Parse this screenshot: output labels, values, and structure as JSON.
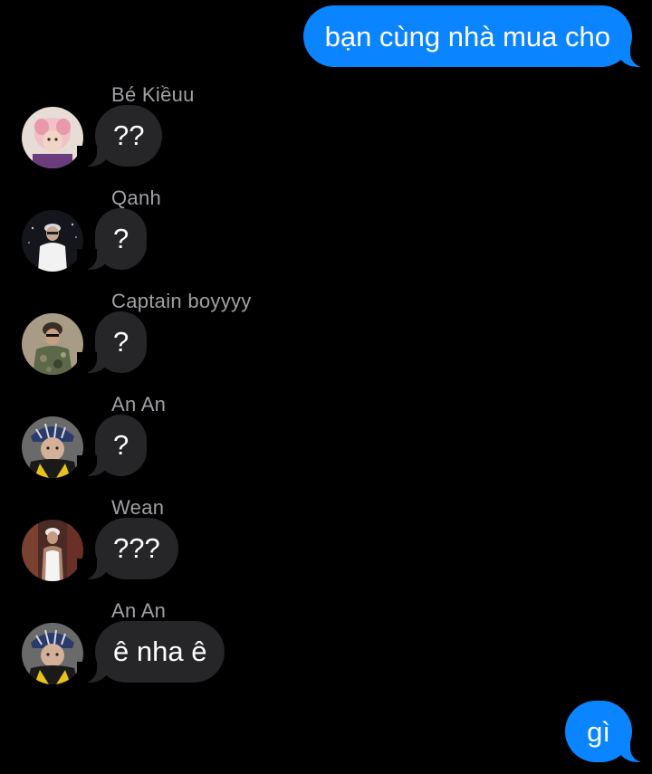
{
  "colors": {
    "background": "#000000",
    "outgoing_bubble": "#0a84ff",
    "incoming_bubble": "#262629",
    "sender_name": "#a0a0a5",
    "text": "#ffffff"
  },
  "messages": {
    "outgoing_1": {
      "text": "bạn cùng nhà mua cho"
    },
    "group_1": {
      "sender": "Bé Kiềuu",
      "text": "??",
      "avatar_icon": "avatar-pink-hair-icon"
    },
    "group_2": {
      "sender": "Qanh",
      "text": "?",
      "avatar_icon": "avatar-white-shirt-icon"
    },
    "group_3": {
      "sender": "Captain boyyyy",
      "text": "?",
      "avatar_icon": "avatar-camo-jacket-icon"
    },
    "group_4": {
      "sender": "An An",
      "text": "?",
      "avatar_icon": "avatar-bandana-yellow-icon"
    },
    "group_5": {
      "sender": "Wean",
      "text": "???",
      "avatar_icon": "avatar-tank-top-icon"
    },
    "group_6": {
      "sender": "An An",
      "text": "ê nha ê",
      "avatar_icon": "avatar-bandana-yellow-icon"
    },
    "outgoing_2": {
      "text": "gì"
    }
  }
}
